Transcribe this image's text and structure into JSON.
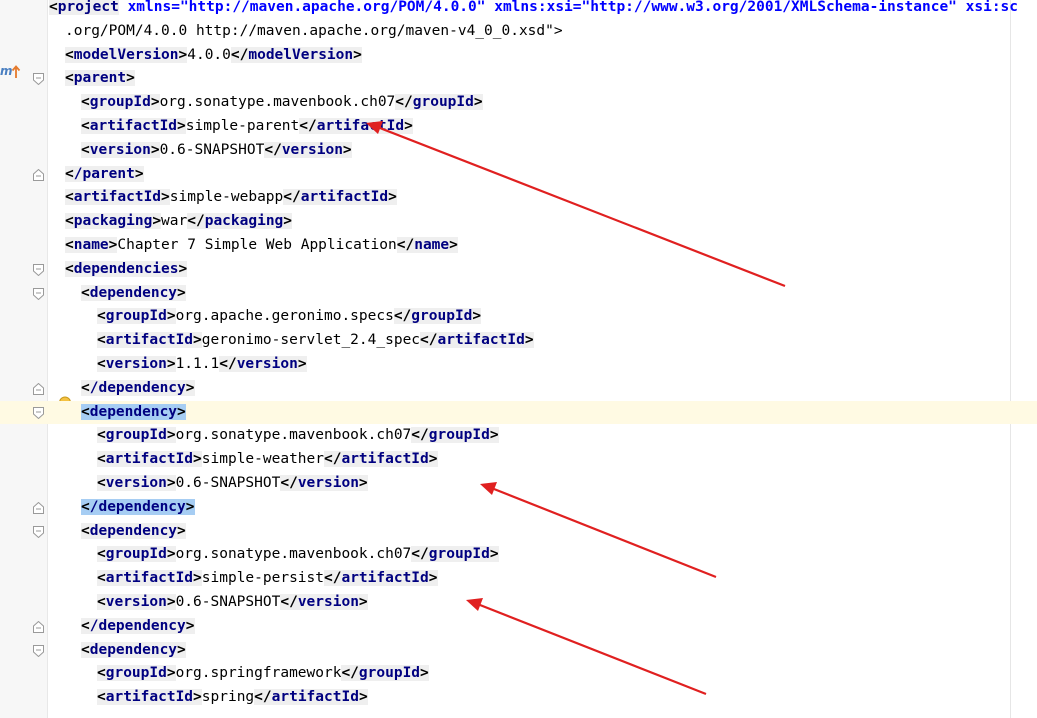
{
  "colors": {
    "tag": "#000080",
    "attr": "#0000ff",
    "attr_value": "#008000",
    "match_highlight": "#a6cdf3",
    "caret_row": "#fffae3",
    "annotation_arrow": "#e02020"
  },
  "icons": {
    "maven": "maven-update-icon",
    "intention": "lightbulb-icon"
  },
  "lines": [
    {
      "pre": "",
      "tag": "project",
      "tail": " xmlns=\"http://maven.apache.org/POM/4.0.0\" xmlns:xsi=\"http://www.w3.org/2001/XMLSchema-instance\" xsi:sc"
    },
    {
      "text": ".org/POM/4.0.0 http://maven.apache.org/maven-v4_0_0.xsd\">"
    },
    {
      "tag": "modelVersion",
      "value": "4.0.0"
    },
    {
      "tag": "parent"
    },
    {
      "tag": "groupId",
      "value": "org.sonatype.mavenbook.ch07"
    },
    {
      "tag": "artifactId",
      "value": "simple-parent"
    },
    {
      "tag": "version",
      "value": "0.6-SNAPSHOT"
    },
    {
      "tag": "/parent"
    },
    {
      "tag": "artifactId",
      "value": "simple-webapp"
    },
    {
      "tag": "packaging",
      "value": "war"
    },
    {
      "tag": "name",
      "value": "Chapter 7 Simple Web Application"
    },
    {
      "tag": "dependencies"
    },
    {
      "tag": "dependency"
    },
    {
      "tag": "groupId",
      "value": "org.apache.geronimo.specs"
    },
    {
      "tag": "artifactId",
      "value": "geronimo-servlet_2.4_spec"
    },
    {
      "tag": "version",
      "value": "1.1.1"
    },
    {
      "tag": "/dependency"
    },
    {
      "tag": "dependency"
    },
    {
      "tag": "groupId",
      "value": "org.sonatype.mavenbook.ch07"
    },
    {
      "tag": "artifactId",
      "value": "simple-weather"
    },
    {
      "tag": "version",
      "value": "0.6-SNAPSHOT"
    },
    {
      "tag": "/dependency"
    },
    {
      "tag": "dependency"
    },
    {
      "tag": "groupId",
      "value": "org.sonatype.mavenbook.ch07"
    },
    {
      "tag": "artifactId",
      "value": "simple-persist"
    },
    {
      "tag": "version",
      "value": "0.6-SNAPSHOT"
    },
    {
      "tag": "/dependency"
    },
    {
      "tag": "dependency"
    },
    {
      "tag": "groupId",
      "value": "org.springframework"
    },
    {
      "tag": "artifactId",
      "value": "spring"
    }
  ]
}
